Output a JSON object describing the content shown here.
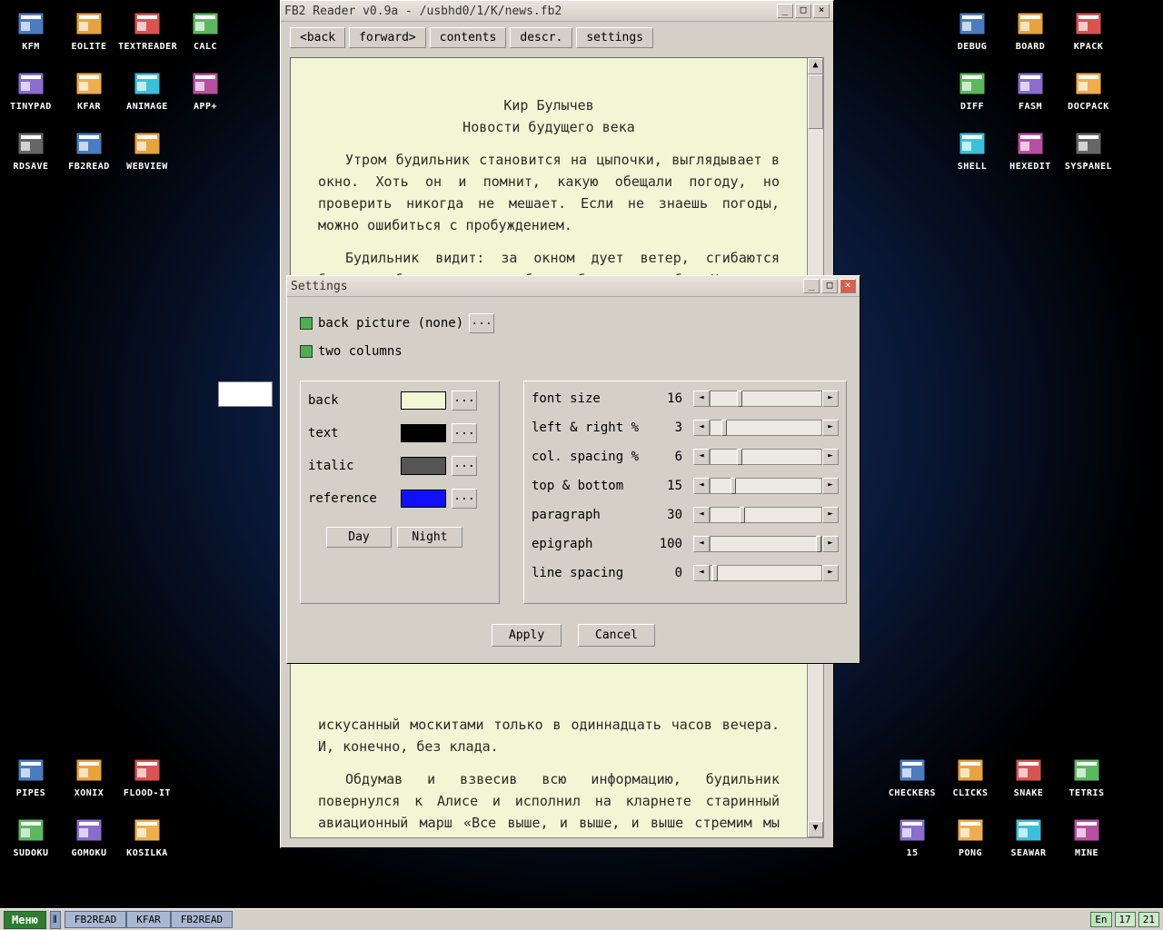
{
  "desktop_left": [
    {
      "label": "KFM"
    },
    {
      "label": "EOLITE"
    },
    {
      "label": "TEXTREADER"
    },
    {
      "label": "CALC"
    },
    {
      "label": "TINYPAD"
    },
    {
      "label": "KFAR"
    },
    {
      "label": "ANIMAGE"
    },
    {
      "label": "APP+"
    },
    {
      "label": "RDSAVE"
    },
    {
      "label": "FB2READ"
    },
    {
      "label": "WEBVIEW"
    }
  ],
  "desktop_right": [
    {
      "label": "DEBUG"
    },
    {
      "label": "BOARD"
    },
    {
      "label": "KPACK"
    },
    {
      "label": "DIFF"
    },
    {
      "label": "FASM"
    },
    {
      "label": "DOCPACK"
    },
    {
      "label": "SHELL"
    },
    {
      "label": "HEXEDIT"
    },
    {
      "label": "SYSPANEL"
    }
  ],
  "desktop_bottom_left": [
    {
      "label": "PIPES"
    },
    {
      "label": "XONIX"
    },
    {
      "label": "FLOOD-IT"
    },
    {
      "label": "SUDOKU"
    },
    {
      "label": "GOMOKU"
    },
    {
      "label": "KOSILKA"
    }
  ],
  "desktop_bottom_right": [
    {
      "label": "CHECKERS"
    },
    {
      "label": "CLICKS"
    },
    {
      "label": "SNAKE"
    },
    {
      "label": "TETRIS"
    },
    {
      "label": "15"
    },
    {
      "label": "PONG"
    },
    {
      "label": "SEAWAR"
    },
    {
      "label": "MINE"
    }
  ],
  "reader": {
    "title": "FB2 Reader v0.9a - /usbhd0/1/K/news.fb2",
    "toolbar": {
      "back": "<back",
      "forward": "forward>",
      "contents": "contents",
      "descr": "descr.",
      "settings": "settings"
    },
    "heading_author": "Кир Булычев",
    "heading_title": "Новости будущего века",
    "p1": "Утром будильник становится на цыпочки, выглядывает в окно. Хоть он и помнит, какую обещали погоду, но проверить никогда не мешает. Если не знаешь погоды, можно ошибиться с пробуждением.",
    "p2": "Будильник видит: за окном дует ветер, сгибаются березки, быстрые серые облака бегут по небу. Но дождя нет и не предвидится.",
    "p3": "искусанный москитами только в одиннадцать часов вечера. И, конечно, без клада.",
    "p4": "Обдумав и взвесив всю информацию, будильник повернулся к Алисе и исполнил на кларнете старинный авиационный марш «Все выше, и выше, и выше стремим мы полет наших птиц!», так как именно эта мелодия именно на кларнете лучше всего подходила для того, чтобы разбудить Алису."
  },
  "settings": {
    "title": "Settings",
    "back_picture": "back picture (none)",
    "two_columns": "two columns",
    "dots": "...",
    "colors": [
      {
        "label": "back",
        "hex": "#f3f6d4"
      },
      {
        "label": "text",
        "hex": "#000000"
      },
      {
        "label": "italic",
        "hex": "#555555"
      },
      {
        "label": "reference",
        "hex": "#1010ff"
      }
    ],
    "day": "Day",
    "night": "Night",
    "sliders": [
      {
        "label": "font size",
        "value": "16",
        "pos": 24
      },
      {
        "label": "left & right %",
        "value": "3",
        "pos": 10
      },
      {
        "label": "col. spacing %",
        "value": "6",
        "pos": 24
      },
      {
        "label": "top & bottom",
        "value": "15",
        "pos": 18
      },
      {
        "label": "paragraph",
        "value": "30",
        "pos": 26
      },
      {
        "label": "epigraph",
        "value": "100",
        "pos": 95
      },
      {
        "label": "line spacing",
        "value": "0",
        "pos": 2
      }
    ],
    "apply": "Apply",
    "cancel": "Cancel"
  },
  "taskbar": {
    "menu": "Меню",
    "tasks": [
      "FB2READ",
      "KFAR",
      "FB2READ"
    ],
    "lang": "En",
    "h": "17",
    "m": "21"
  }
}
